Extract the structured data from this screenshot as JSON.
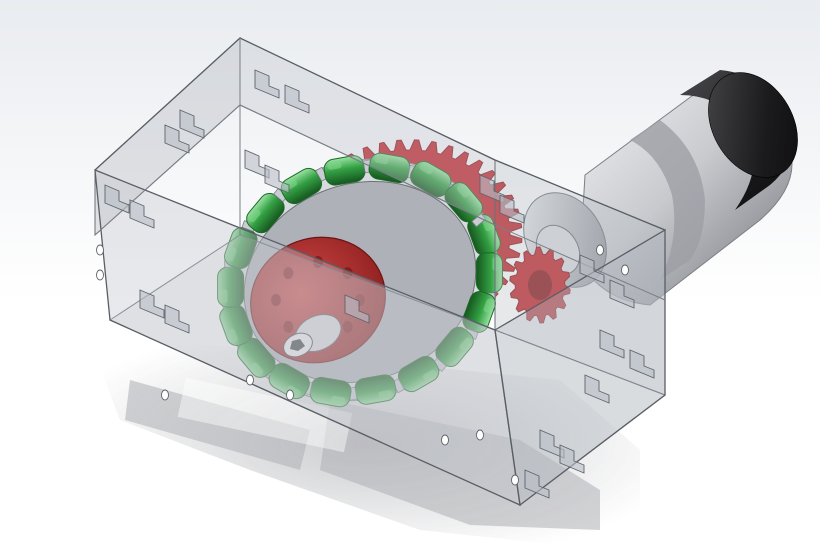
{
  "viewport": {
    "background": "#ffffff",
    "view_gradient_top": "#e9ecf0",
    "view_gradient_bottom": "#ffffff"
  },
  "model": {
    "colors": {
      "enclosure_fill": "#b9bec6",
      "enclosure_edge": "#5f646b",
      "wheel_hub": "#b02a2a",
      "wheel_hub_dark": "#7f1717",
      "gear": "#c1272d",
      "gear_dark": "#8a1a1e",
      "roller": "#2f9a3e",
      "roller_light": "#7fd88a",
      "roller_dark": "#1c6a27",
      "rim_metal": "#c9ccd2",
      "rim_metal_dark": "#7c8088",
      "motor_body": "#c5c7cb",
      "motor_body_dark": "#8d9097",
      "motor_cap": "#1b1b1d",
      "shadow": "#8b8e93"
    },
    "parts": [
      "box-enclosure",
      "omni-wheel",
      "spur-gear",
      "pinion-gear",
      "gear-motor",
      "axle-bolt"
    ]
  }
}
